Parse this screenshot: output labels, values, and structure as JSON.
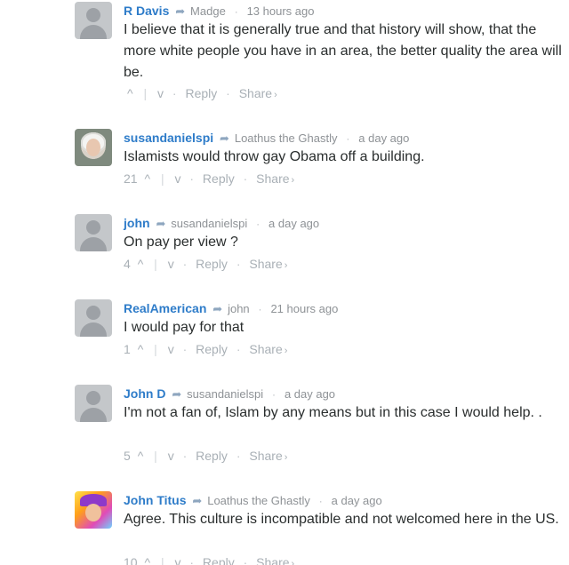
{
  "comments": [
    {
      "author": "R Davis",
      "parent": "Madge",
      "time": "13 hours ago",
      "text": "I believe that it is generally true and that history will show, that the more white people you have in an area, the better quality the area will be.",
      "votes": "",
      "avatar": "default-avatar"
    },
    {
      "author": "susandanielspi",
      "parent": "Loathus the Ghastly",
      "time": "a day ago",
      "text": "Islamists would throw gay Obama off a building.",
      "votes": "21",
      "avatar": "photo-avatar"
    },
    {
      "author": "john",
      "parent": "susandanielspi",
      "time": "a day ago",
      "text": "On pay per view ?",
      "votes": "4",
      "avatar": "default-avatar"
    },
    {
      "author": "RealAmerican",
      "parent": "john",
      "time": "21 hours ago",
      "text": "I would pay for that",
      "votes": "1",
      "avatar": "default-avatar"
    },
    {
      "author": "John D",
      "parent": "susandanielspi",
      "time": "a day ago",
      "text": "I'm not a fan of, Islam by any means but in this case I would help. .",
      "votes": "5",
      "avatar": "default-avatar"
    },
    {
      "author": "John Titus",
      "parent": "Loathus the Ghastly",
      "time": "a day ago",
      "text": "Agree. This culture is incompatible and not welcomed here in the US.",
      "votes": "10",
      "avatar": "photo-avatar"
    }
  ],
  "actions": {
    "reply": "Reply",
    "share": "Share",
    "upvote_icon": "^",
    "downvote_icon": "v",
    "share_chevron": "›",
    "reply_arrow": "➦",
    "separator": "·"
  },
  "colors": {
    "author": "#2e7cc9",
    "meta": "#8e9296",
    "body": "#2a2e2e",
    "actions": "#a9b0b6"
  }
}
